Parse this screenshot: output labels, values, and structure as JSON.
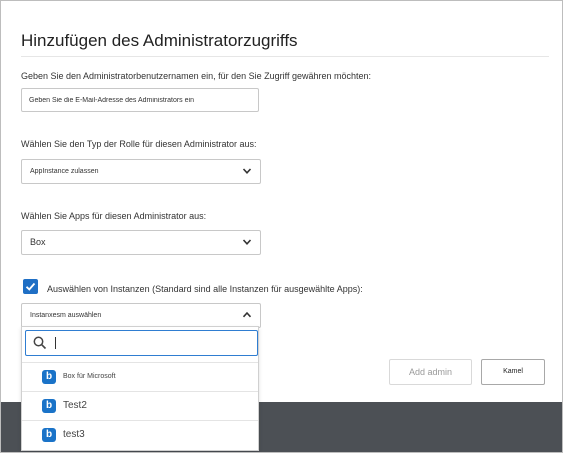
{
  "dialog": {
    "title": "Hinzufügen des Administratorzugriffs",
    "username_label": "Geben Sie den Administratorbenutzernamen ein, für den Sie Zugriff gewähren möchten:",
    "username_value": "Geben Sie die E-Mail-Adresse des Administrators ein",
    "role_label": "Wählen Sie den Typ der Rolle für diesen Administrator aus:",
    "role_value": "AppInstance zulassen",
    "apps_label": "Wählen Sie Apps für diesen Administrator aus:",
    "apps_value": "Box",
    "instances_checkbox_checked": true,
    "instances_label": "Auswählen von Instanzen (Standard sind alle Instanzen für ausgewählte Apps):",
    "instances_value": "Instanxesm auswählen",
    "instances_search_value": "",
    "instances_options": [
      {
        "label": "Box für Microsoft",
        "icon": "box-app-icon",
        "glyph": "b"
      },
      {
        "label": "Test2",
        "icon": "box-app-icon",
        "glyph": "b"
      },
      {
        "label": "test3",
        "icon": "box-app-icon",
        "glyph": "b"
      }
    ],
    "add_button": "Add admin",
    "cancel_button": "Kamel"
  },
  "colors": {
    "accent": "#1f6fc5",
    "backdrop": "#4c5055"
  }
}
